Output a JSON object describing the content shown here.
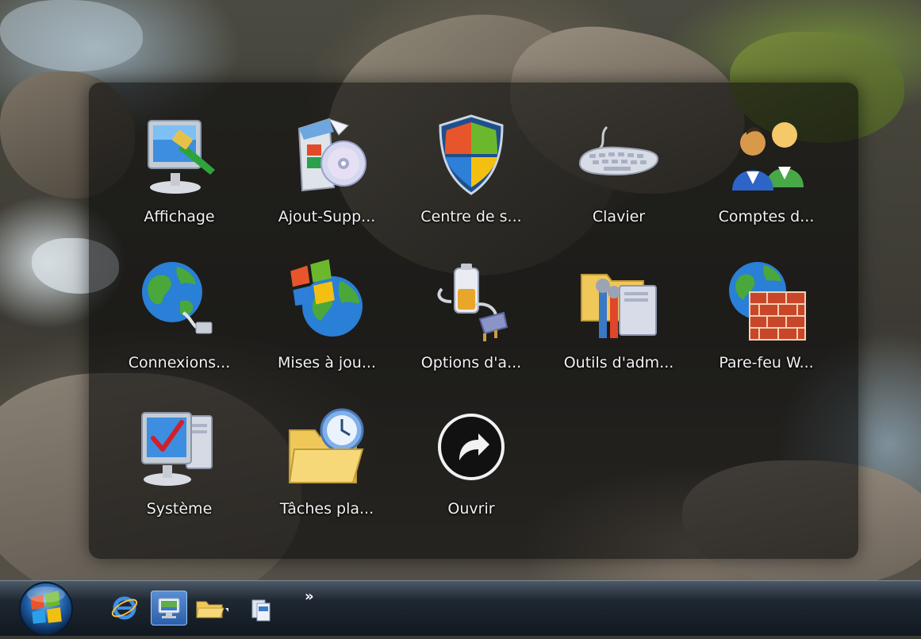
{
  "control_panel": {
    "items": [
      {
        "label": "Affichage",
        "icon": "display-settings-icon"
      },
      {
        "label": "Ajout-Supp...",
        "icon": "add-remove-programs-icon"
      },
      {
        "label": "Centre de s...",
        "icon": "security-center-shield-icon"
      },
      {
        "label": "Clavier",
        "icon": "keyboard-icon"
      },
      {
        "label": "Comptes d...",
        "icon": "user-accounts-icon"
      },
      {
        "label": "Connexions...",
        "icon": "network-connections-icon"
      },
      {
        "label": "Mises à jou...",
        "icon": "windows-update-icon"
      },
      {
        "label": "Options d'a...",
        "icon": "power-options-icon"
      },
      {
        "label": "Outils d'adm...",
        "icon": "administrative-tools-icon"
      },
      {
        "label": "Pare-feu W...",
        "icon": "firewall-icon"
      },
      {
        "label": "Système",
        "icon": "system-icon"
      },
      {
        "label": "Tâches pla...",
        "icon": "scheduled-tasks-icon"
      },
      {
        "label": "Ouvrir",
        "icon": "open-arrow-icon"
      }
    ]
  },
  "taskbar": {
    "start_button": "windows-start-orb-icon",
    "quick_launch": [
      {
        "icon": "internet-explorer-icon"
      },
      {
        "icon": "show-desktop-icon"
      },
      {
        "icon": "folder-explorer-icon"
      },
      {
        "icon": "switch-windows-icon"
      }
    ],
    "overflow": "»"
  },
  "colors": {
    "panel": "#0a0a0a",
    "label_text": "#f2f2f2",
    "taskbar": "#1f2832"
  }
}
